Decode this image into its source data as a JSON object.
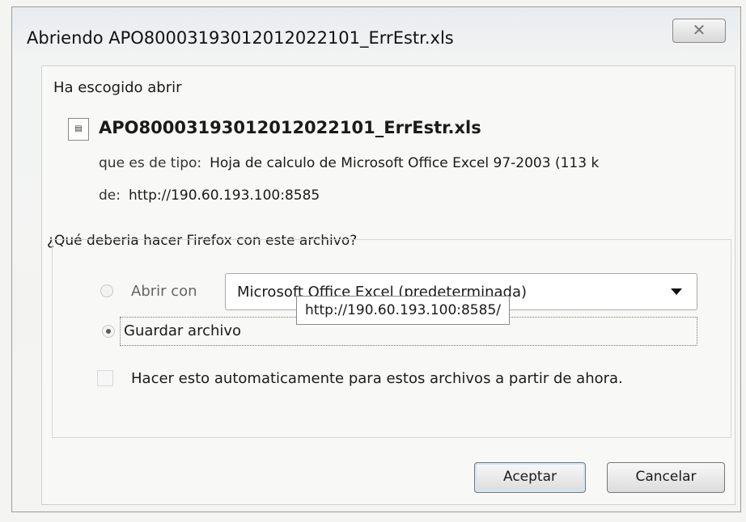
{
  "dialog": {
    "title": "Abriendo APO80003193012012022101_ErrEstr.xls",
    "close_icon": "close-icon"
  },
  "content": {
    "intro": "Ha escogido abrir",
    "file_icon": "excel-file-icon",
    "file_name": "APO80003193012012022101_ErrEstr.xls",
    "type_label": "que es de tipo:",
    "type_value": "Hoja de calculo de Microsoft Office Excel 97-2003 (113 k",
    "from_label": "de:",
    "from_value": "http://190.60.193.100:8585"
  },
  "question": "¿Qué deberia hacer Firefox con este archivo?",
  "tooltip": "http://190.60.193.100:8585/",
  "options": {
    "open_with_label": "Abrir con",
    "open_with_value": "Microsoft Office Excel (predeterminada)",
    "save_label": "Guardar archivo",
    "auto_label": "Hacer esto automaticamente para estos archivos a partir de ahora."
  },
  "buttons": {
    "ok": "Aceptar",
    "cancel": "Cancelar"
  }
}
